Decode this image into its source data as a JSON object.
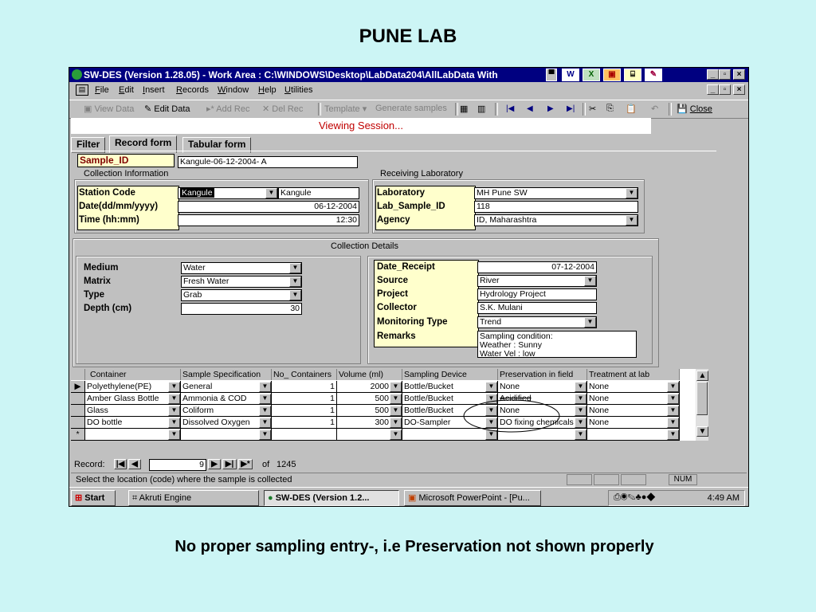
{
  "slide": {
    "title": "PUNE LAB",
    "caption": "No proper sampling entry-, i.e Preservation not shown properly"
  },
  "window": {
    "title": "SW-DES (Version 1.28.05) - Work Area : C:\\WINDOWS\\Desktop\\LabData204\\AllLabData With",
    "menus": [
      "File",
      "Edit",
      "Insert",
      "Records",
      "Window",
      "Help",
      "Utilities"
    ],
    "toolbar": {
      "view_data": "View Data",
      "edit_data": "Edit Data",
      "add_rec": "Add Rec",
      "del_rec": "Del Rec",
      "template": "Template",
      "generate": "Generate samples",
      "close": "Close"
    },
    "session": "Viewing Session...",
    "tabs": [
      "Filter",
      "Record form",
      "Tabular form"
    ]
  },
  "form": {
    "sample_id_label": "Sample_ID",
    "sample_id": "Kangule-06-12-2004- A",
    "collection_info": "Collection Information",
    "receiving_lab": "Receiving Laboratory",
    "station_code_label": "Station Code",
    "station_code": "Kangule",
    "station_name": "Kangule",
    "date_label": "Date(dd/mm/yyyy)",
    "date": "06-12-2004",
    "time_label": "Time (hh:mm)",
    "time": "12:30",
    "laboratory_label": "Laboratory",
    "laboratory": "MH Pune SW",
    "lab_sample_id_label": "Lab_Sample_ID",
    "lab_sample_id": "118",
    "agency_label": "Agency",
    "agency": "ID, Maharashtra",
    "collection_details": "Collection Details",
    "medium_label": "Medium",
    "medium": "Water",
    "matrix_label": "Matrix",
    "matrix": "Fresh Water",
    "type_label": "Type",
    "type": "Grab",
    "depth_label": "Depth (cm)",
    "depth": "30",
    "date_receipt_label": "Date_Receipt",
    "date_receipt": "07-12-2004",
    "source_label": "Source",
    "source": "River",
    "project_label": "Project",
    "project": "Hydrology Project",
    "collector_label": "Collector",
    "collector": "S.K. Mulani",
    "monitoring_type_label": "Monitoring Type",
    "monitoring_type": "Trend",
    "remarks_label": "Remarks",
    "remarks_1": "Sampling condition:",
    "remarks_2": "Weather : Sunny",
    "remarks_3": "Water Vel : low"
  },
  "grid": {
    "headers": [
      "Container",
      "Sample Specification",
      "No_ Containers",
      "Volume (ml)",
      "Sampling Device",
      "Preservation in field",
      "Treatment at lab"
    ],
    "rows": [
      [
        "Polyethylene(PE)",
        "General",
        "1",
        "2000",
        "Bottle/Bucket",
        "None",
        "None"
      ],
      [
        "Amber Glass Bottle",
        "Ammonia & COD",
        "1",
        "500",
        "Bottle/Bucket",
        "Acidified",
        "None"
      ],
      [
        "Glass",
        "Coliform",
        "1",
        "500",
        "Bottle/Bucket",
        "None",
        "None"
      ],
      [
        "DO bottle",
        "Dissolved Oxygen",
        "1",
        "300",
        "DO-Sampler",
        "DO fixing chemicals",
        "None"
      ]
    ]
  },
  "record_bar": {
    "label": "Record:",
    "current": "9",
    "of": "of",
    "total": "1245"
  },
  "status": {
    "message": "Select the location (code) where the sample is collected",
    "num": "NUM"
  },
  "taskbar": {
    "start": "Start",
    "items": [
      "Akruti Engine",
      "SW-DES (Version 1.2...",
      "Microsoft PowerPoint - [Pu..."
    ],
    "clock": "4:49 AM"
  }
}
